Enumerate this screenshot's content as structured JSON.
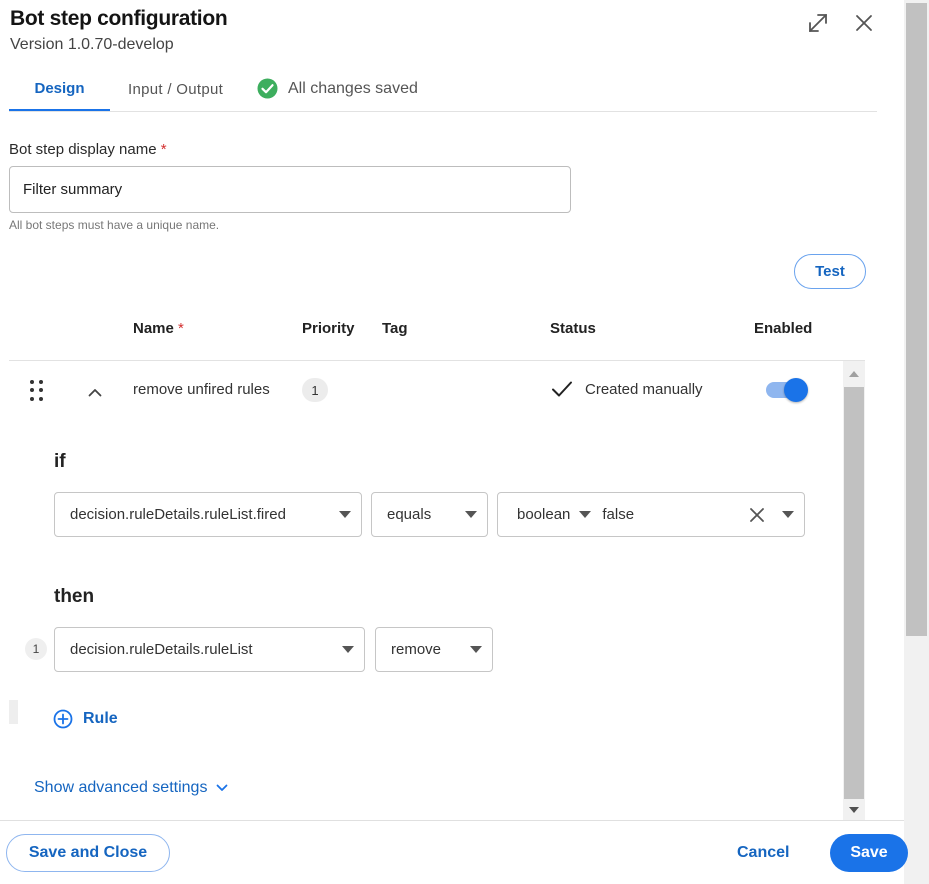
{
  "header": {
    "title": "Bot step configuration",
    "version": "Version 1.0.70-develop"
  },
  "tabs": [
    {
      "label": "Design",
      "active": true
    },
    {
      "label": "Input / Output",
      "active": false
    }
  ],
  "save_status": "All changes saved",
  "display_name": {
    "label": "Bot step display name",
    "required_mark": "*",
    "value": "Filter summary",
    "helper": "All bot steps must have a unique name."
  },
  "test_label": "Test",
  "table": {
    "columns": {
      "name": "Name",
      "name_required": "*",
      "priority": "Priority",
      "tag": "Tag",
      "status": "Status",
      "enabled": "Enabled"
    },
    "rule": {
      "name": "remove unfired rules",
      "priority": "1",
      "status": "Created manually",
      "enabled": true
    }
  },
  "condition": {
    "if_label": "if",
    "field": "decision.ruleDetails.ruleList.fired",
    "operator": "equals",
    "value_type": "boolean",
    "value": "false"
  },
  "action": {
    "then_label": "then",
    "step_number": "1",
    "field": "decision.ruleDetails.ruleList",
    "operation": "remove"
  },
  "add_rule_label": "Rule",
  "advanced_label": "Show advanced settings",
  "footer": {
    "save_close": "Save and Close",
    "cancel": "Cancel",
    "save": "Save"
  },
  "colors": {
    "accent": "#1a73e8",
    "success": "#3dae5e",
    "required": "#d32f2f"
  }
}
